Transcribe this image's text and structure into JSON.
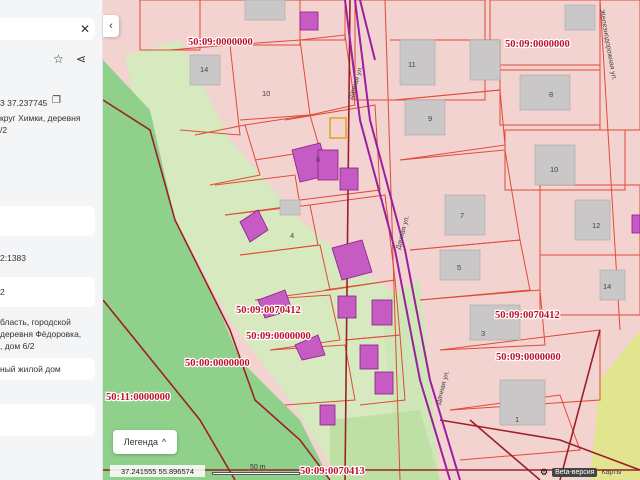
{
  "colors": {
    "parcel_fill": "#f3d3cf",
    "parcel_border": "#e04a3a",
    "building_fill": "#c9c7c8",
    "oks_fill": "#c65bc3",
    "forest_fill": "#8fd18a",
    "green_zone_fill": "#cfe7b8",
    "road_line": "#9b1fa0",
    "quarter_line": "#9e1f2b",
    "accent": "#d9a520"
  },
  "panel": {
    "close_icon": "close-icon",
    "star_icon": "star-icon",
    "share_icon": "share-icon",
    "coord_text": "3 37.237745",
    "copy_icon": "copy-icon",
    "address_lines": [
      "круг Химки, деревня",
      "/2"
    ],
    "cadastral_number": "2:1383",
    "field_value": "2",
    "full_address_lines": [
      "бласть, городской",
      "деревня Фёдоровка,",
      ", дом 6/2"
    ],
    "object_type": "ный жилой дом"
  },
  "map": {
    "cadastral_labels": [
      {
        "text": "50:09:0000000"
      },
      {
        "text": "50:09:0000000"
      },
      {
        "text": "50:09:0070412"
      },
      {
        "text": "50:09:0000000"
      },
      {
        "text": "50:00:0000000"
      },
      {
        "text": "50:09:0070412"
      },
      {
        "text": "50:09:0000000"
      },
      {
        "text": "50:11:0000000"
      },
      {
        "text": "50:09:0070413"
      }
    ],
    "parcel_numbers": [
      "14",
      "10",
      "11",
      "8",
      "9",
      "6",
      "10",
      "7",
      "12",
      "5",
      "4",
      "14",
      "3",
      "1"
    ],
    "streets": [
      "Дачная ул.",
      "Дачная ул.",
      "Дачная ул.",
      "Железнодорожная ул."
    ]
  },
  "controls": {
    "collapse_label": "‹",
    "legend_label": "Легенда",
    "legend_chevron": "^",
    "coordinates": "37.241555   55.896574",
    "scale_label": "50 m",
    "beta_label": "Beta-версия",
    "maps_label": "Карты"
  }
}
